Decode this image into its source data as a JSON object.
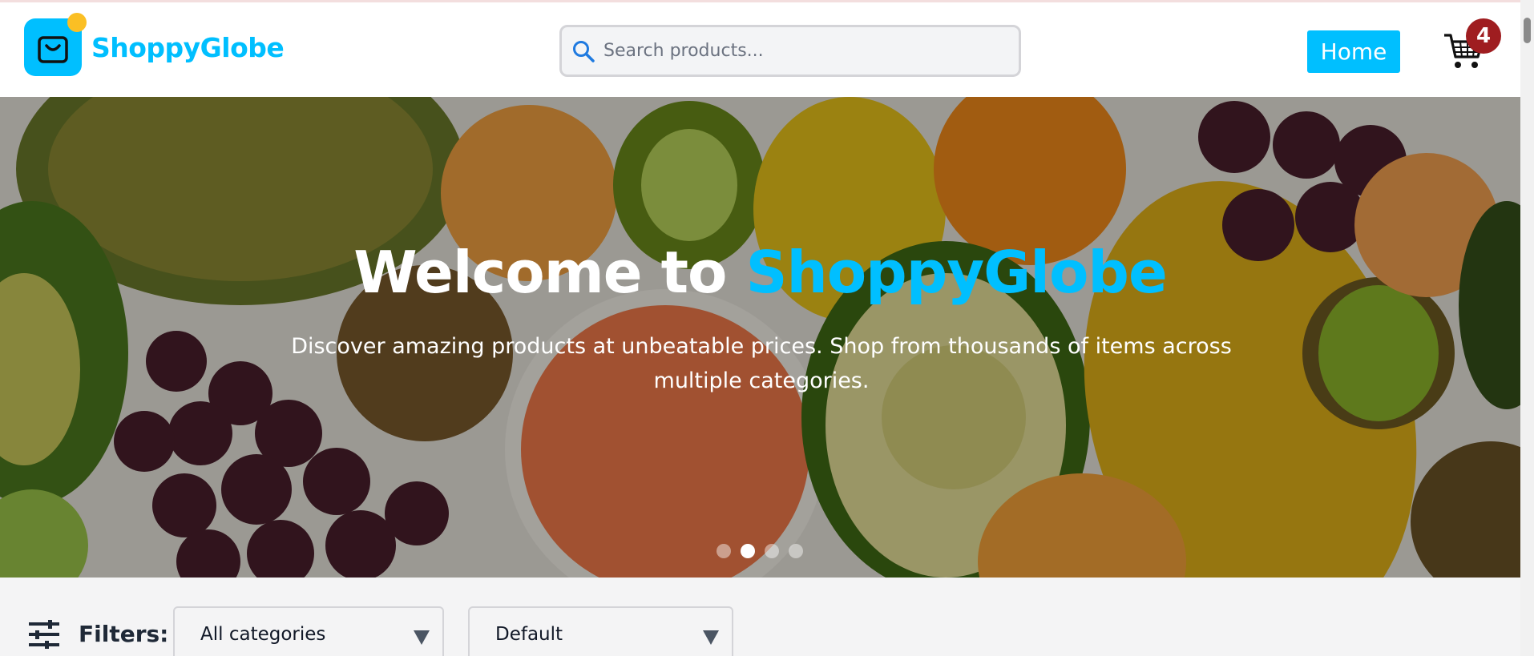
{
  "header": {
    "brand": "ShoppyGlobe",
    "search_placeholder": "Search products...",
    "home_label": "Home",
    "cart_count": "4"
  },
  "hero": {
    "title_prefix": "Welcome to",
    "title_accent": "ShoppyGlobe",
    "subtitle": "Discover amazing products at unbeatable prices. Shop from thousands of items across multiple categories.",
    "carousel_dots": 4,
    "active_dot": 2
  },
  "filters": {
    "label": "Filters:",
    "category_value": "All categories",
    "sort_value": "Default"
  },
  "colors": {
    "brand": "#00bfff",
    "badge": "#9f1d20",
    "logo_dot": "#fbbf24"
  },
  "icons": [
    "shopping-bag-icon",
    "search-icon",
    "cart-icon",
    "filter-sliders-icon",
    "caret-down-icon"
  ]
}
